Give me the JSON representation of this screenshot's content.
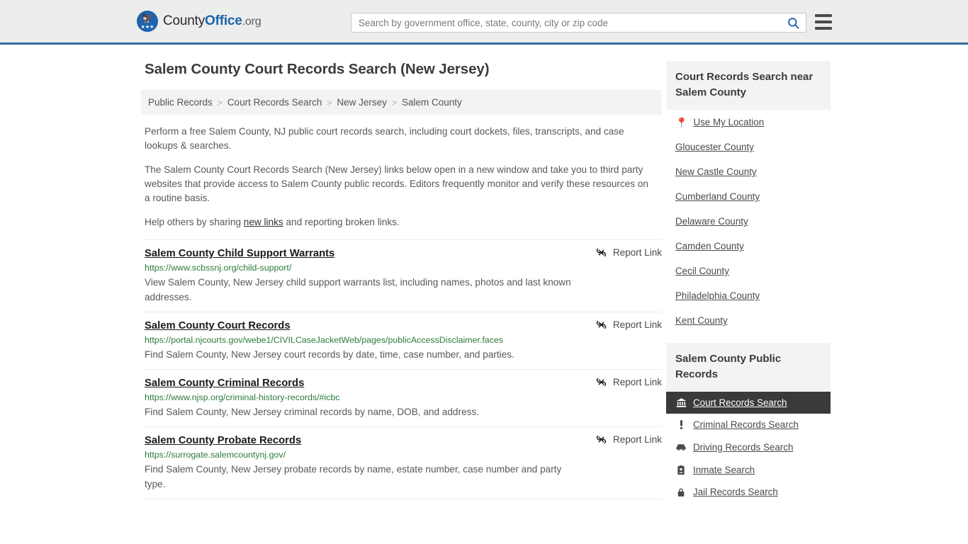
{
  "header": {
    "logo": {
      "seal_icon": "eagle-seal-icon",
      "text_county": "County",
      "text_office": "Office",
      "text_org": ".org"
    },
    "search": {
      "placeholder": "Search by government office, state, county, city or zip code",
      "value": "",
      "search_icon": "search-icon"
    },
    "menu_icon": "hamburger-menu-icon"
  },
  "main": {
    "title": "Salem County Court Records Search (New Jersey)",
    "breadcrumb": [
      "Public Records",
      "Court Records Search",
      "New Jersey",
      "Salem County"
    ],
    "breadcrumb_separator": ">",
    "intro_1": "Perform a free Salem County, NJ public court records search, including court dockets, files, transcripts, and case lookups & searches.",
    "intro_2": "The Salem County Court Records Search (New Jersey) links below open in a new window and take you to third party websites that provide access to Salem County public records. Editors frequently monitor and verify these resources on a routine basis.",
    "intro_3_before": "Help others by sharing ",
    "intro_3_link": "new links",
    "intro_3_after": " and reporting broken links.",
    "report_link_label": "Report Link",
    "report_link_icon": "broken-link-icon",
    "results": [
      {
        "title": "Salem County Child Support Warrants",
        "url": "https://www.scbssnj.org/child-support/",
        "description": "View Salem County, New Jersey child support warrants list, including names, photos and last known addresses."
      },
      {
        "title": "Salem County Court Records",
        "url": "https://portal.njcourts.gov/webe1/CIVILCaseJacketWeb/pages/publicAccessDisclaimer.faces",
        "description": "Find Salem County, New Jersey court records by date, time, case number, and parties."
      },
      {
        "title": "Salem County Criminal Records",
        "url": "https://www.njsp.org/criminal-history-records/#icbc",
        "description": "Find Salem County, New Jersey criminal records by name, DOB, and address."
      },
      {
        "title": "Salem County Probate Records",
        "url": "https://surrogate.salemcountynj.gov/",
        "description": "Find Salem County, New Jersey probate records by name, estate number, case number and party type."
      }
    ]
  },
  "sidebar": {
    "nearby": {
      "heading": "Court Records Search near Salem County",
      "use_my_location": "Use My Location",
      "location_icon": "map-pin-icon",
      "counties": [
        "Gloucester County",
        "New Castle County",
        "Cumberland County",
        "Delaware County",
        "Camden County",
        "Cecil County",
        "Philadelphia County",
        "Kent County"
      ]
    },
    "public_records": {
      "heading": "Salem County Public Records",
      "items": [
        {
          "label": "Court Records Search",
          "icon": "courthouse-icon",
          "active": true
        },
        {
          "label": "Criminal Records Search",
          "icon": "exclamation-icon",
          "active": false
        },
        {
          "label": "Driving Records Search",
          "icon": "car-icon",
          "active": false
        },
        {
          "label": "Inmate Search",
          "icon": "id-badge-icon",
          "active": false
        },
        {
          "label": "Jail Records Search",
          "icon": "lock-icon",
          "active": false
        }
      ]
    }
  },
  "colors": {
    "brand_blue": "#1d63ad",
    "header_border": "#31699e",
    "url_green": "#2b7a3d",
    "active_bg": "#3a3a3a"
  }
}
